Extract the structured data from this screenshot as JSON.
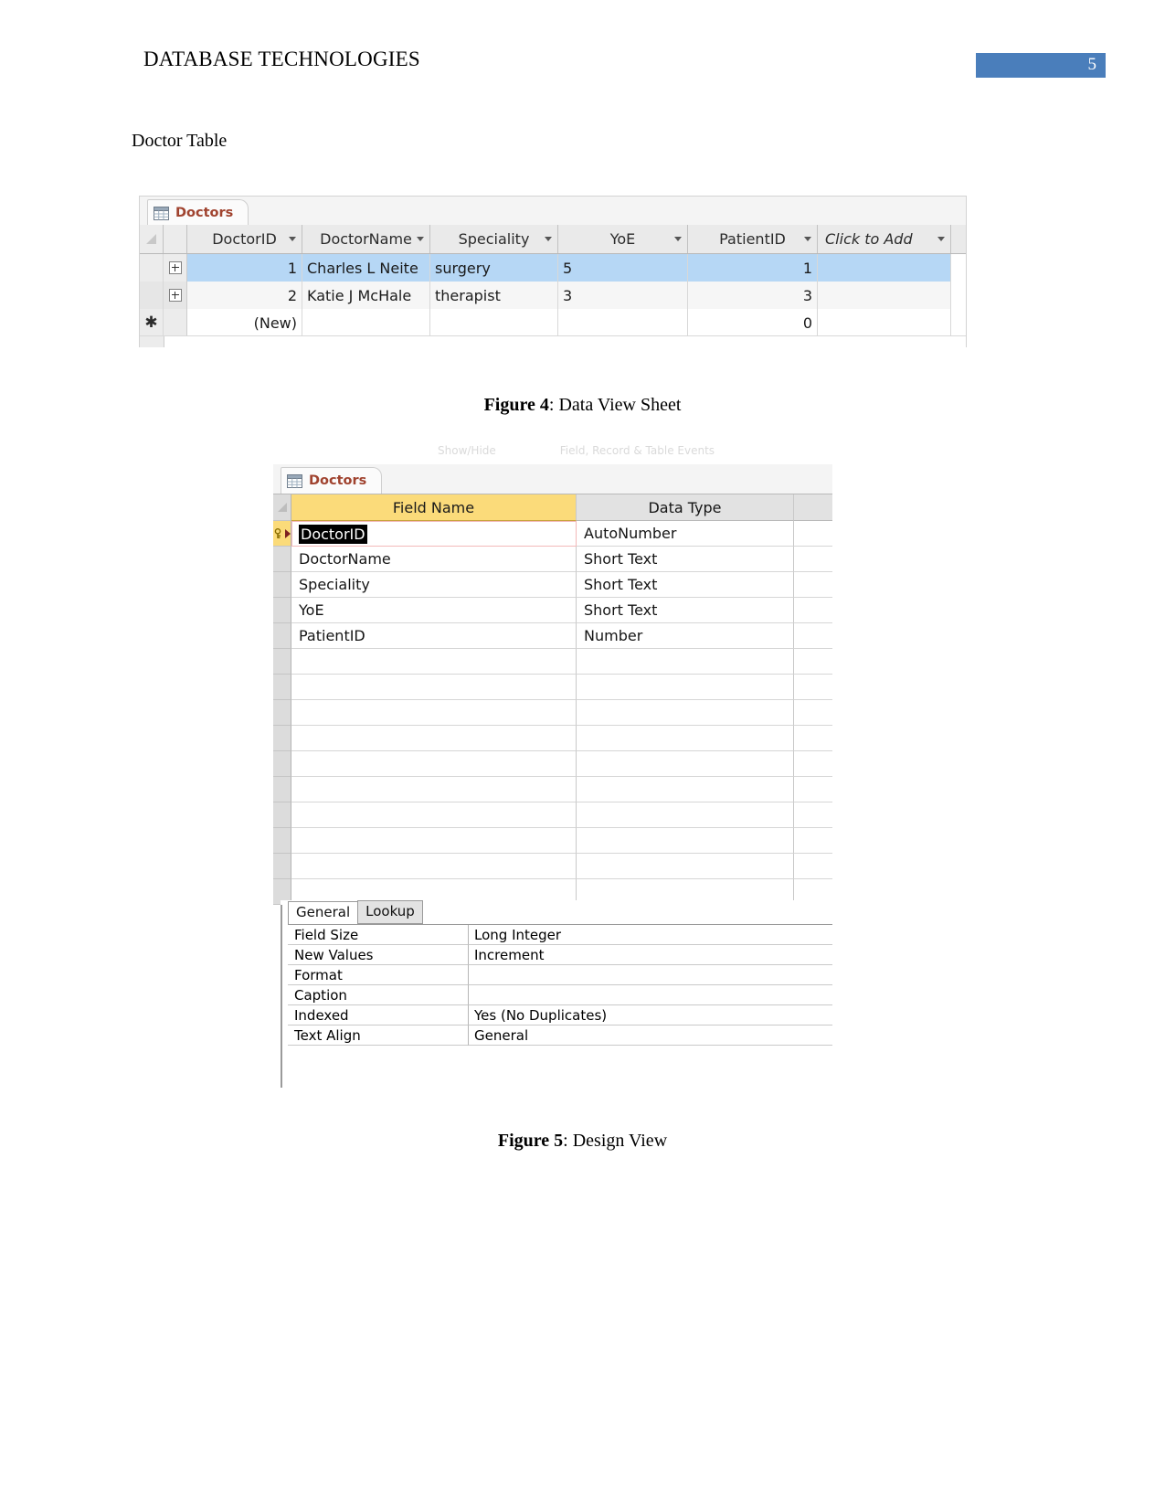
{
  "header": {
    "doc_title": "DATABASE TECHNOLOGIES",
    "page_number": "5",
    "page_number_bg": "#4a7ebb"
  },
  "body": {
    "section_label": "Doctor Table"
  },
  "figure4": {
    "caption_bold": "Figure 4",
    "caption_rest": ": Data View Sheet",
    "tab": {
      "label": "Doctors",
      "icon": "table-icon"
    },
    "columns": [
      {
        "label": "DoctorID",
        "sort_icon": "chevron-down-icon"
      },
      {
        "label": "DoctorName",
        "sort_icon": "chevron-down-icon"
      },
      {
        "label": "Speciality",
        "sort_icon": "chevron-down-icon"
      },
      {
        "label": "YoE",
        "sort_icon": "chevron-down-icon"
      },
      {
        "label": "PatientID",
        "sort_icon": "chevron-down-icon"
      },
      {
        "label": "Click to Add",
        "sort_icon": "chevron-down-icon"
      }
    ],
    "rows": [
      {
        "expander": "plus-icon",
        "DoctorID": "1",
        "DoctorName": "Charles L Neite",
        "Speciality": "surgery",
        "YoE": "5",
        "PatientID": "1",
        "ClickToAdd": "",
        "selected": true
      },
      {
        "expander": "plus-icon",
        "DoctorID": "2",
        "DoctorName": "Katie J McHale",
        "Speciality": "therapist",
        "YoE": "3",
        "PatientID": "3",
        "ClickToAdd": "",
        "selected": false
      }
    ],
    "new_row": {
      "marker": "asterisk-icon",
      "DoctorID": "(New)",
      "DoctorName": "",
      "Speciality": "",
      "YoE": "",
      "PatientID": "0",
      "ClickToAdd": ""
    },
    "selection_color": "#b6d7f5"
  },
  "figure5": {
    "caption_bold": "Figure 5",
    "caption_rest": ": Design View",
    "ribbon_ghost": [
      "Show/Hide",
      "Field, Record & Table Events"
    ],
    "tab": {
      "label": "Doctors",
      "icon": "table-icon"
    },
    "columns": [
      "Field Name",
      "Data Type",
      ""
    ],
    "field_name_header_bg": "#fbdb7a",
    "fields": [
      {
        "name": "DoctorID",
        "type": "AutoNumber",
        "primary_key": true,
        "focused": true
      },
      {
        "name": "DoctorName",
        "type": "Short Text",
        "primary_key": false,
        "focused": false
      },
      {
        "name": "Speciality",
        "type": "Short Text",
        "primary_key": false,
        "focused": false
      },
      {
        "name": "YoE",
        "type": "Short Text",
        "primary_key": false,
        "focused": false
      },
      {
        "name": "PatientID",
        "type": "Number",
        "primary_key": false,
        "focused": false
      }
    ],
    "empty_row_count": 10
  },
  "field_properties": {
    "tabs": [
      {
        "label": "General",
        "active": true
      },
      {
        "label": "Lookup",
        "active": false
      }
    ],
    "rows": [
      {
        "key": "Field Size",
        "value": "Long Integer"
      },
      {
        "key": "New Values",
        "value": "Increment"
      },
      {
        "key": "Format",
        "value": ""
      },
      {
        "key": "Caption",
        "value": ""
      },
      {
        "key": "Indexed",
        "value": "Yes (No Duplicates)"
      },
      {
        "key": "Text Align",
        "value": "General"
      }
    ]
  }
}
